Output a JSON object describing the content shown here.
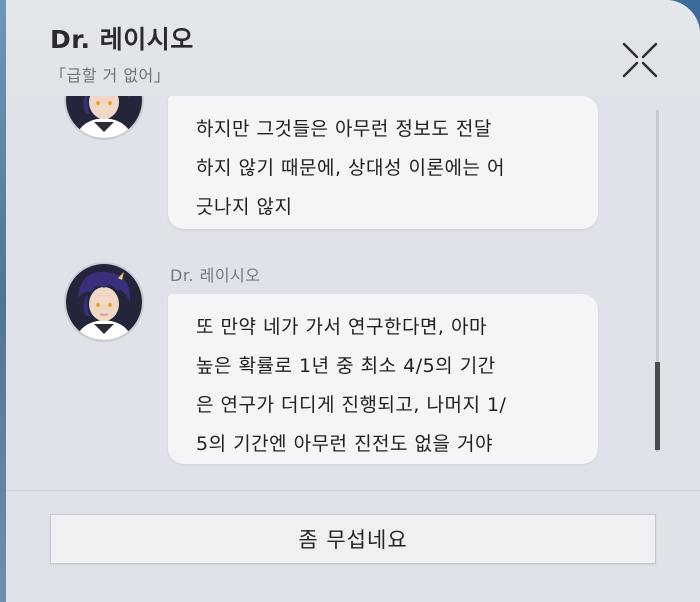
{
  "dialog": {
    "title": "Dr. 레이시오",
    "subtitle": "「급할 거 없어」"
  },
  "messages": [
    {
      "speaker": "",
      "avatar_icon": "dr-ratio-avatar",
      "lines": [
        "하지만 그것들은 아무런 정보도 전달",
        "하지 않기 때문에, 상대성 이론에는 어",
        "긋나지 않지"
      ]
    },
    {
      "speaker": "Dr. 레이시오",
      "avatar_icon": "dr-ratio-avatar",
      "lines": [
        "또 만약 네가 가서 연구한다면, 아마",
        "높은 확률로 1년 중 최소 4/5의 기간",
        "은 연구가 더디게 진행되고, 나머지 1/",
        "5의 기간엔 아무런 진전도 없을 거야"
      ]
    }
  ],
  "options": [
    {
      "label": "좀 무섭네요"
    }
  ],
  "colors": {
    "panel": "#dfe2e8",
    "bubble": "#f4f5f7",
    "hair": "#3a2f7a",
    "eyes": "#e4a72c"
  }
}
